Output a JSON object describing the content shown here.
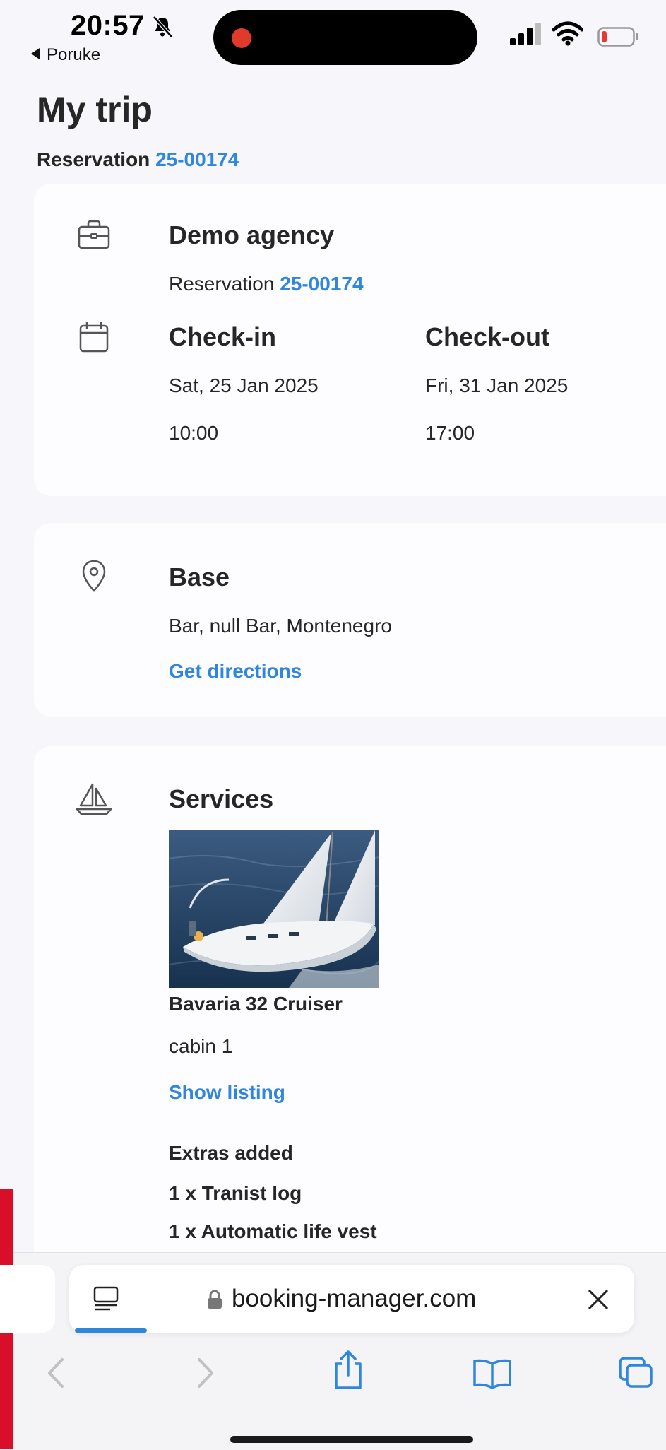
{
  "status_bar": {
    "time": "20:57",
    "back_app": "Poruke",
    "silent_icon": "bell-slash-icon",
    "recording_color": "#e03a2c",
    "battery_level_color": "#e53935"
  },
  "page": {
    "title": "My trip",
    "reservation_label": "Reservation",
    "reservation_number": "25-00174"
  },
  "agency_card": {
    "icon": "briefcase-icon",
    "agency_name": "Demo agency",
    "reservation_label": "Reservation",
    "reservation_number": "25-00174",
    "calendar_icon": "calendar-icon",
    "checkin_label": "Check-in",
    "checkin_date": "Sat, 25 Jan 2025",
    "checkin_time": "10:00",
    "checkout_label": "Check-out",
    "checkout_date": "Fri, 31 Jan 2025",
    "checkout_time": "17:00"
  },
  "base_card": {
    "icon": "location-pin-icon",
    "title": "Base",
    "address": "Bar, null Bar, Montenegro",
    "directions_link": "Get directions"
  },
  "services_card": {
    "icon": "sailboat-icon",
    "title": "Services",
    "boat_name": "Bavaria 32 Cruiser",
    "cabin": "cabin 1",
    "listing_link": "Show listing",
    "extras_title": "Extras added",
    "extras": [
      "1 x Tranist log",
      "1 x Automatic life vest"
    ]
  },
  "browser": {
    "url": "booking-manager.com",
    "accent_color": "#2f86dc"
  }
}
